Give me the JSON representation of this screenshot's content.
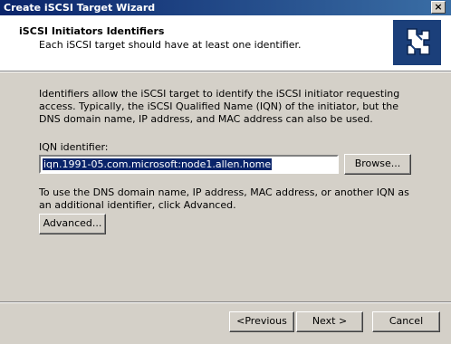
{
  "window": {
    "title": "Create iSCSI Target Wizard",
    "close_glyph": "×"
  },
  "header": {
    "title": "iSCSI Initiators Identifiers",
    "subtitle": "Each iSCSI target should have at least one identifier.",
    "logo_icon": "wizard-puzzle-icon"
  },
  "body": {
    "description": "Identifiers allow the iSCSI target to identify the iSCSI initiator requesting access. Typically, the iSCSI Qualified Name (IQN) of the initiator, but the DNS domain name, IP address, and MAC address can also be used.",
    "iqn_label": "IQN identifier:",
    "iqn_value": "iqn.1991-05.com.microsoft:node1.allen.home",
    "browse_label": "Browse...",
    "advanced_text": "To use the DNS domain name, IP address, MAC address, or another IQN as an additional identifier, click Advanced.",
    "advanced_label": "Advanced..."
  },
  "footer": {
    "previous_label": "<Previous",
    "next_label": "Next >",
    "cancel_label": "Cancel"
  },
  "colors": {
    "titlebar": "#0a246a",
    "selection": "#0a246a",
    "dialog_bg": "#d4d0c8"
  }
}
